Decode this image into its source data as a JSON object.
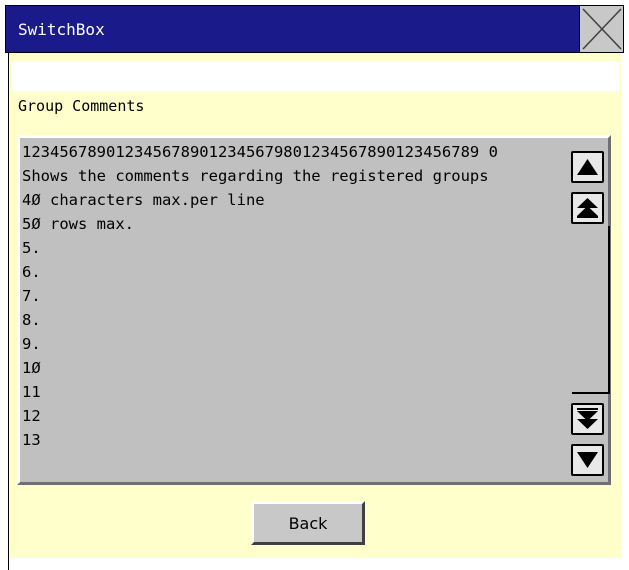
{
  "window": {
    "title": "SwitchBox"
  },
  "close_icon": "close-x-icon",
  "section": {
    "label": "Group Comments"
  },
  "comments": {
    "lines": [
      "1234567890123456789012345679801234567890123456789 0",
      "Shows the comments regarding the registered groups",
      "4Ø characters max.per line",
      "5Ø rows max.",
      "5.",
      "6.",
      "7.",
      "8.",
      "9.",
      "1Ø",
      "11",
      "12",
      "13"
    ]
  },
  "scrollbar": {
    "icons": [
      "scroll-up-icon",
      "page-up-icon",
      "page-down-icon",
      "scroll-down-icon"
    ]
  },
  "back_button": {
    "label": "Back"
  }
}
